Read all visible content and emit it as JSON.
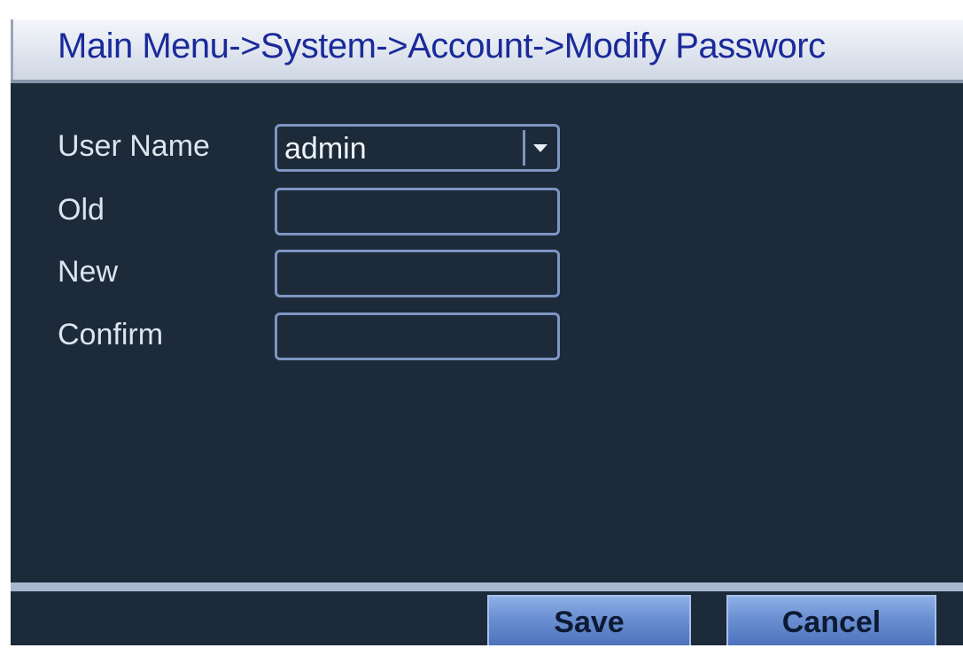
{
  "title": "Main Menu->System->Account->Modify Passworc",
  "form": {
    "user_name_label": "User Name",
    "user_name_value": "admin",
    "old_label": "Old",
    "old_value": "",
    "new_label": "New",
    "new_value": "",
    "confirm_label": "Confirm",
    "confirm_value": ""
  },
  "buttons": {
    "save": "Save",
    "cancel": "Cancel"
  },
  "colors": {
    "panel_background": "#1c2a3a",
    "title_text": "#1a2a9a",
    "field_border": "#7d95c2",
    "button_fill": "#6a8fd2"
  },
  "icons": {
    "dropdown": "chevron-down-icon"
  }
}
